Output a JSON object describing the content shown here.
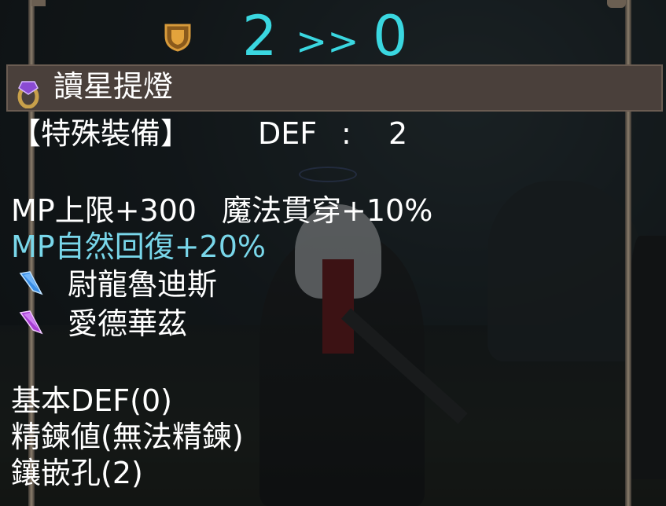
{
  "upgrade": {
    "from": "2",
    "arrow": ">>",
    "to": "0"
  },
  "item": {
    "name": "讀星提燈"
  },
  "info": {
    "type": "【特殊裝備】",
    "def_label": "DEF",
    "def_sep": ":",
    "def_value": "2"
  },
  "stats": {
    "line1": "MP上限+300",
    "line2": "魔法貫穿+10%",
    "line3": "MP自然回復+20%"
  },
  "gems": [
    {
      "name": "尉龍魯迪斯",
      "icon": "blue-crystal-icon",
      "color": "#4aa4ff"
    },
    {
      "name": "愛德華茲",
      "icon": "purple-crystal-icon",
      "color": "#c24ee6"
    }
  ],
  "details": {
    "base_def": "基本DEF(0)",
    "refine": "精鍊値(無法精鍊)",
    "slots": "鑲嵌孔(2)"
  },
  "colors": {
    "upgrade": "#3ad7e0",
    "highlight": "#79d7ea",
    "name_bar": "#4a403b"
  }
}
